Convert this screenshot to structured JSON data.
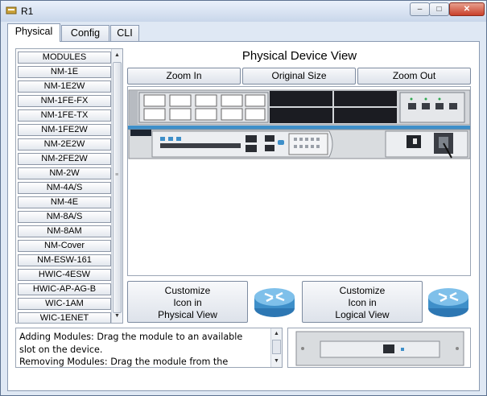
{
  "window": {
    "title": "R1",
    "min": "–",
    "max": "□",
    "close": "✕"
  },
  "tabs": [
    {
      "label": "Physical"
    },
    {
      "label": "Config"
    },
    {
      "label": "CLI"
    }
  ],
  "modules": {
    "items": [
      "MODULES",
      "NM-1E",
      "NM-1E2W",
      "NM-1FE-FX",
      "NM-1FE-TX",
      "NM-1FE2W",
      "NM-2E2W",
      "NM-2FE2W",
      "NM-2W",
      "NM-4A/S",
      "NM-4E",
      "NM-8A/S",
      "NM-8AM",
      "NM-Cover",
      "NM-ESW-161",
      "HWIC-4ESW",
      "HWIC-AP-AG-B",
      "WIC-1AM",
      "WIC-1ENET"
    ]
  },
  "view": {
    "title": "Physical Device View",
    "zoom_in": "Zoom In",
    "original_size": "Original Size",
    "zoom_out": "Zoom Out"
  },
  "customize": {
    "physical": [
      "Customize",
      "Icon in",
      "Physical View"
    ],
    "logical": [
      "Customize",
      "Icon in",
      "Logical View"
    ]
  },
  "info": {
    "text": "Adding Modules: Drag the module to an available\n slot on the device.\nRemoving Modules: Drag the module from the"
  },
  "icons": {
    "title": "router-app-icon",
    "router": "router-icon",
    "up": "scroll-up-arrow",
    "down": "scroll-down-arrow"
  },
  "colors": {
    "router_blue": "#3e8fc9",
    "chassis": "#d3d6da",
    "panel_dark": "#1c2430",
    "accent": "#4a7cbf"
  }
}
